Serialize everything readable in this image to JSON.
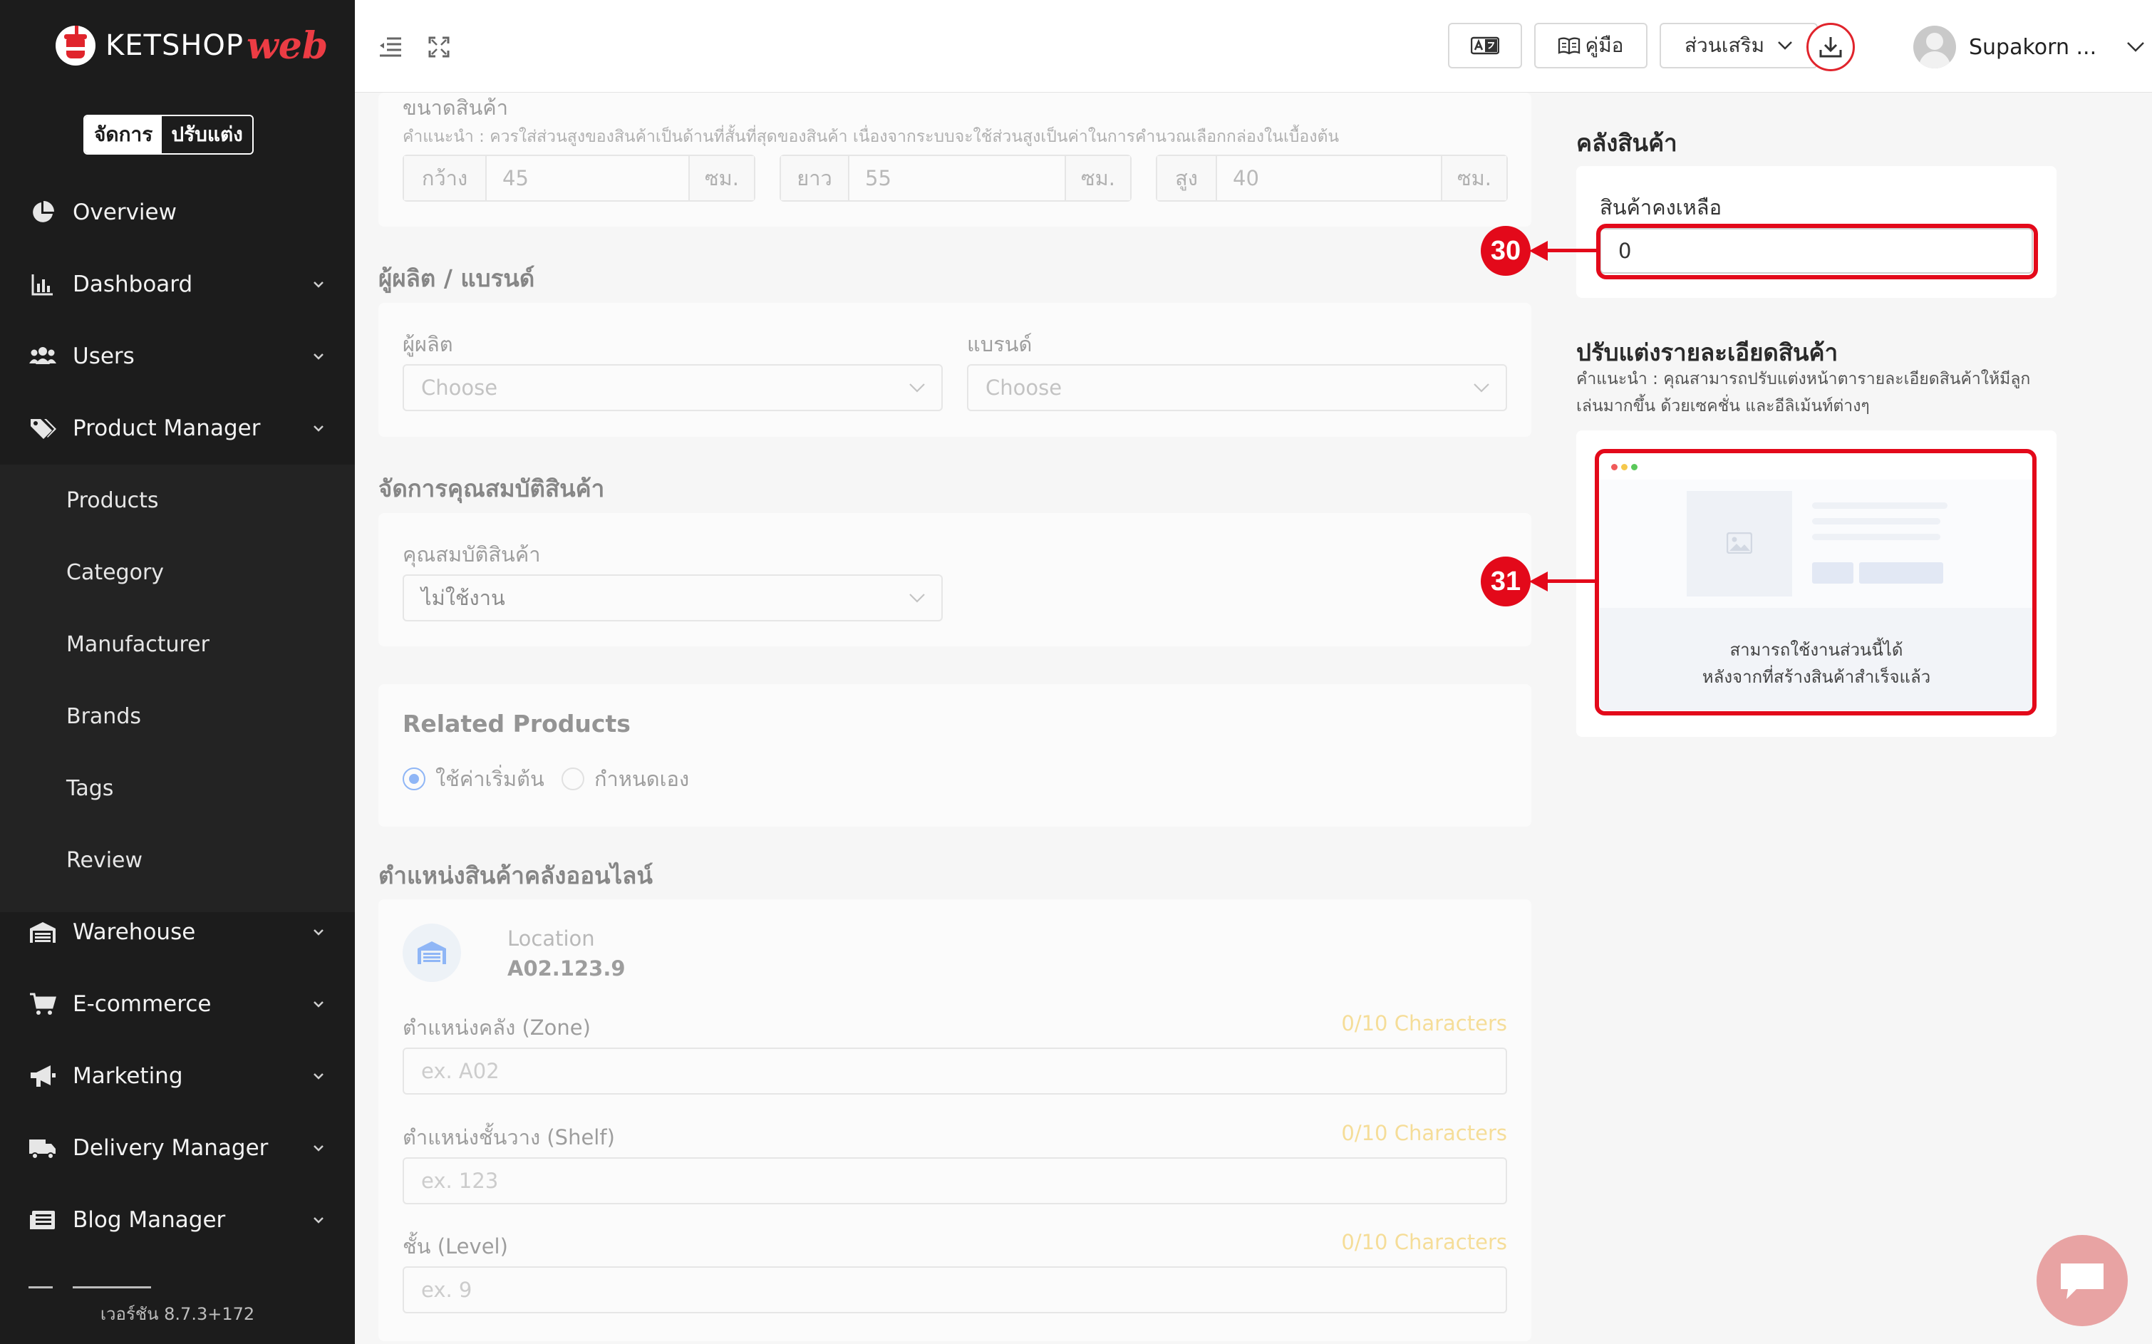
{
  "brand": {
    "name": "KETSHOP",
    "suffix": "web"
  },
  "mode_toggle": {
    "active": "จัดการ",
    "inactive": "ปรับแต่ง"
  },
  "sidebar": {
    "items": [
      {
        "label": "Overview",
        "icon": "pie-chart-icon",
        "has_children": false
      },
      {
        "label": "Dashboard",
        "icon": "bar-chart-icon",
        "has_children": true
      },
      {
        "label": "Users",
        "icon": "users-icon",
        "has_children": true
      },
      {
        "label": "Product Manager",
        "icon": "tags-icon",
        "has_children": true,
        "expanded": true
      },
      {
        "label": "Warehouse",
        "icon": "warehouse-icon",
        "has_children": true
      },
      {
        "label": "E-commerce",
        "icon": "cart-icon",
        "has_children": true
      },
      {
        "label": "Marketing",
        "icon": "megaphone-icon",
        "has_children": true
      },
      {
        "label": "Delivery Manager",
        "icon": "truck-icon",
        "has_children": true
      },
      {
        "label": "Blog Manager",
        "icon": "newspaper-icon",
        "has_children": true
      }
    ],
    "sub_items": [
      "Products",
      "Category",
      "Manufacturer",
      "Brands",
      "Tags",
      "Review"
    ],
    "version": "เวอร์ชัน 8.7.3+172"
  },
  "header": {
    "translate_icon": "translate-icon",
    "manual_label": "คู่มือ",
    "addons_label": "ส่วนเสริม",
    "user_name": "Supakorn ..."
  },
  "dimensions": {
    "title": "ขนาดสินค้า",
    "hint": "คำแนะนำ : ควรใส่ส่วนสูงของสินค้าเป็นด้านที่สั้นที่สุดของสินค้า เนื่องจากระบบจะใช้ส่วนสูงเป็นค่าในการคำนวณเลือกกล่องในเบื้องต้น",
    "unit": "ซม.",
    "width": {
      "label": "กว้าง",
      "value": "45"
    },
    "length": {
      "label": "ยาว",
      "value": "55"
    },
    "height": {
      "label": "สูง",
      "value": "40"
    }
  },
  "maker_brand": {
    "title": "ผู้ผลิต / แบรนด์",
    "manufacturer_label": "ผู้ผลิต",
    "brand_label": "แบรนด์",
    "placeholder": "Choose"
  },
  "attributes": {
    "title": "จัดการคุณสมบัติสินค้า",
    "label": "คุณสมบัติสินค้า",
    "value": "ไม่ใช้งาน"
  },
  "related": {
    "title": "Related Products",
    "option_default": "ใช้ค่าเริ่มต้น",
    "option_custom": "กำหนดเอง",
    "selected": "default"
  },
  "location": {
    "title": "ตำแหน่งสินค้าคลังออนไลน์",
    "caption": "Location",
    "code": "A02.123.9",
    "zone_label": "ตำแหน่งคลัง (Zone)",
    "zone_placeholder": "ex. A02",
    "shelf_label": "ตำแหน่งชั้นวาง (Shelf)",
    "shelf_placeholder": "ex. 123",
    "level_label": "ชั้น (Level)",
    "level_placeholder": "ex. 9",
    "counter": "0/10 Characters"
  },
  "stock": {
    "title": "คลังสินค้า",
    "label": "สินค้าคงเหลือ",
    "value": "0"
  },
  "customize": {
    "title": "ปรับแต่งรายละเอียดสินค้า",
    "hint_line1": "คำแนะนำ : คุณสามารถปรับแต่งหน้าตารายละเอียดสินค้าให้มีลูก",
    "hint_line2": "เล่นมากขึ้น ด้วยเซคชั่น และอีลิเม้นท์ต่างๆ",
    "preview_line1": "สามารถใช้งานส่วนนี้ได้",
    "preview_line2": "หลังจากที่สร้างสินค้าสำเร็จแล้ว"
  },
  "annotations": {
    "marker_stock": "30",
    "marker_customize": "31"
  },
  "colors": {
    "annotation_red": "#e3091a",
    "counter_yellow": "#f5c84c",
    "sidebar_bg": "#1c1c1c",
    "accent_blue": "#3b82f6"
  }
}
